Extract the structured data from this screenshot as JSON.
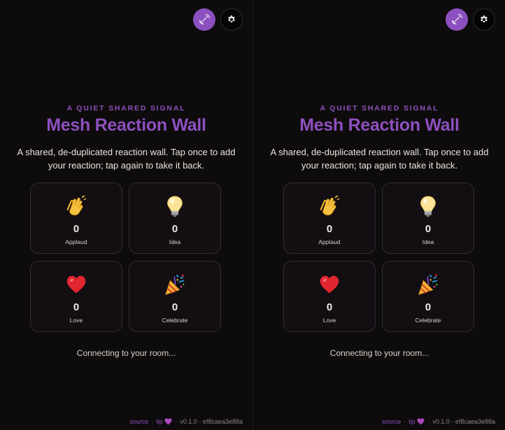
{
  "panes": [
    {
      "header": {
        "eyebrow": "A QUIET SHARED SIGNAL",
        "title": "Mesh Reaction Wall",
        "description": "A shared, de-duplicated reaction wall. Tap once to add your reaction; tap again to take it back."
      },
      "reactions": [
        {
          "icon": "clapping-hands-icon",
          "count": "0",
          "label": "Applaud"
        },
        {
          "icon": "light-bulb-icon",
          "count": "0",
          "label": "Idea"
        },
        {
          "icon": "heart-icon",
          "count": "0",
          "label": "Love"
        },
        {
          "icon": "party-popper-icon",
          "count": "0",
          "label": "Celebrate"
        }
      ],
      "status": "Connecting to your room...",
      "footer": {
        "source": "source",
        "tip": "tip 💜",
        "version": "v0.1.0 · ef8caea3e88a"
      }
    },
    {
      "header": {
        "eyebrow": "A QUIET SHARED SIGNAL",
        "title": "Mesh Reaction Wall",
        "description": "A shared, de-duplicated reaction wall. Tap once to add your reaction; tap again to take it back."
      },
      "reactions": [
        {
          "icon": "clapping-hands-icon",
          "count": "0",
          "label": "Applaud"
        },
        {
          "icon": "light-bulb-icon",
          "count": "0",
          "label": "Idea"
        },
        {
          "icon": "heart-icon",
          "count": "0",
          "label": "Love"
        },
        {
          "icon": "party-popper-icon",
          "count": "0",
          "label": "Celebrate"
        }
      ],
      "status": "Connecting to your room...",
      "footer": {
        "source": "source",
        "tip": "tip 💜",
        "version": "v0.1.0 · ef8caea3e88a"
      }
    }
  ],
  "colors": {
    "accent": "#8d50bf",
    "background": "#0d0b0b",
    "card_border": "#332c36"
  }
}
